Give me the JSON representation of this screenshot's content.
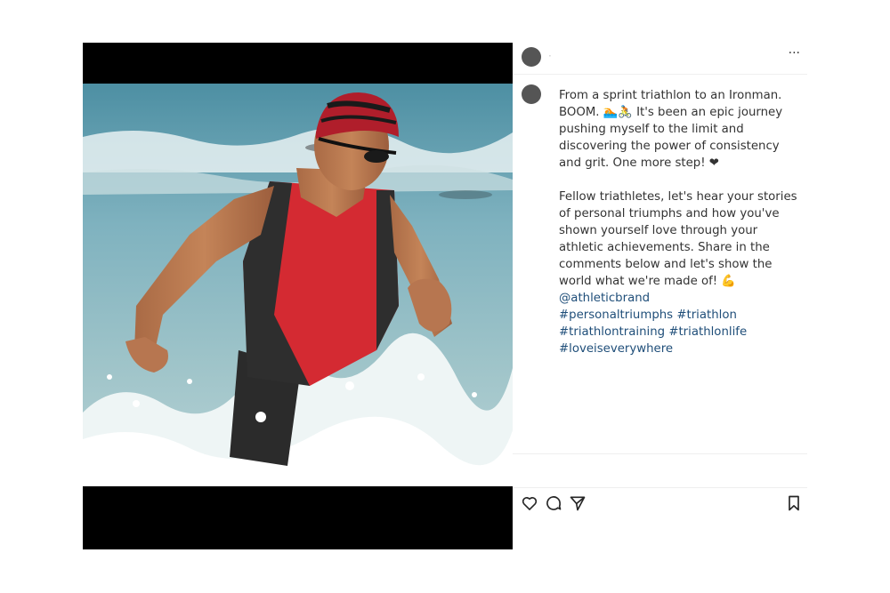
{
  "post": {
    "username": "·",
    "more_label": "···",
    "caption": {
      "paragraph1": "From a sprint triathlon to an Ironman. BOOM. 🏊‍🚴 It's been an epic journey pushing myself to the limit and discovering the power of consistency and grit. One more step! ❤",
      "paragraph2": "Fellow triathletes, let's hear your stories of personal triumphs and how you've shown yourself love through your athletic achievements. Share in the comments below and let's show the world what we're made of! 💪",
      "mention": "@athleticbrand",
      "hashtags": [
        "#personaltriumphs",
        "#triathlon",
        "#triathlontraining",
        "#triathlonlife",
        "#loveiseverywhere"
      ]
    },
    "actions": {
      "like_icon": "heart-icon",
      "comment_icon": "comment-icon",
      "share_icon": "send-icon",
      "save_icon": "bookmark-icon"
    },
    "colors": {
      "link": "#1f4e79",
      "avatar": "#555555",
      "swim_cap": "#b01e2b",
      "suit_red": "#d42a32"
    }
  }
}
